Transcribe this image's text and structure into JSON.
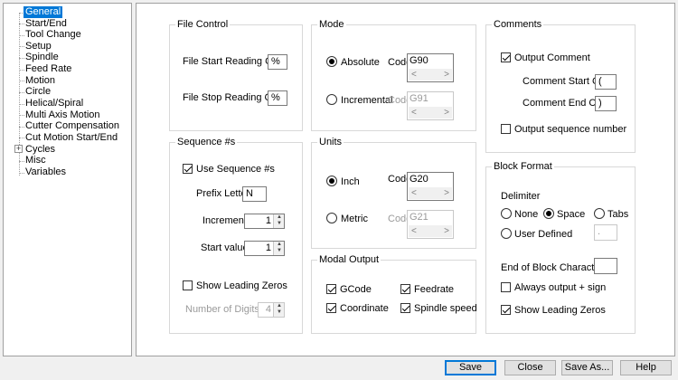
{
  "tree": {
    "items": [
      {
        "label": "General",
        "selected": true
      },
      {
        "label": "Start/End"
      },
      {
        "label": "Tool Change"
      },
      {
        "label": "Setup"
      },
      {
        "label": "Spindle"
      },
      {
        "label": "Feed Rate"
      },
      {
        "label": "Motion"
      },
      {
        "label": "Circle"
      },
      {
        "label": "Helical/Spiral"
      },
      {
        "label": "Multi Axis Motion"
      },
      {
        "label": "Cutter Compensation"
      },
      {
        "label": "Cut Motion Start/End"
      },
      {
        "label": "Cycles",
        "expandable": true
      },
      {
        "label": "Misc"
      },
      {
        "label": "Variables"
      }
    ]
  },
  "file_control": {
    "title": "File Control",
    "start_label": "File Start Reading Char",
    "start_value": "%",
    "stop_label": "File Stop Reading Char",
    "stop_value": "%"
  },
  "mode": {
    "title": "Mode",
    "absolute_label": "Absolute",
    "absolute_code_label": "Code",
    "absolute_code": "G90",
    "incremental_label": "Incremental",
    "incremental_code_label": "Code",
    "incremental_code": "G91",
    "selected": "absolute"
  },
  "comments": {
    "title": "Comments",
    "output_comment_label": "Output Comment",
    "output_comment_checked": true,
    "start_char_label": "Comment Start Char",
    "start_char": "(",
    "end_char_label": "Comment End Char",
    "end_char": ")",
    "output_seq_label": "Output sequence number",
    "output_seq_checked": false
  },
  "sequence": {
    "title": "Sequence #s",
    "use_label": "Use Sequence #s",
    "use_checked": true,
    "prefix_label": "Prefix Letter",
    "prefix_value": "N",
    "increment_label": "Increment",
    "increment_value": "1",
    "start_label": "Start value",
    "start_value": "1",
    "leading_label": "Show Leading Zeros",
    "leading_checked": false,
    "digits_label": "Number of Digits",
    "digits_value": "4"
  },
  "units": {
    "title": "Units",
    "inch_label": "Inch",
    "inch_code_label": "Code",
    "inch_code": "G20",
    "metric_label": "Metric",
    "metric_code_label": "Code",
    "metric_code": "G21",
    "selected": "inch"
  },
  "modal_output": {
    "title": "Modal Output",
    "gcode_label": "GCode",
    "feedrate_label": "Feedrate",
    "coordinate_label": "Coordinate",
    "spindle_label": "Spindle speed"
  },
  "block_format": {
    "title": "Block Format",
    "delimiter_label": "Delimiter",
    "none_label": "None",
    "space_label": "Space",
    "tabs_label": "Tabs",
    "user_defined_label": "User Defined",
    "user_defined_value": ".",
    "selected": "space",
    "eob_label": "End of Block Character",
    "eob_value": "",
    "always_sign_label": "Always output + sign",
    "always_sign_checked": false,
    "leading_label": "Show Leading Zeros",
    "leading_checked": true
  },
  "buttons": {
    "save": "Save",
    "close": "Close",
    "save_as": "Save As...",
    "help": "Help"
  },
  "icons": {
    "expander": "plus-icon",
    "spin": "spin-arrows-icon",
    "scroll": "scroll-arrows-icon"
  }
}
